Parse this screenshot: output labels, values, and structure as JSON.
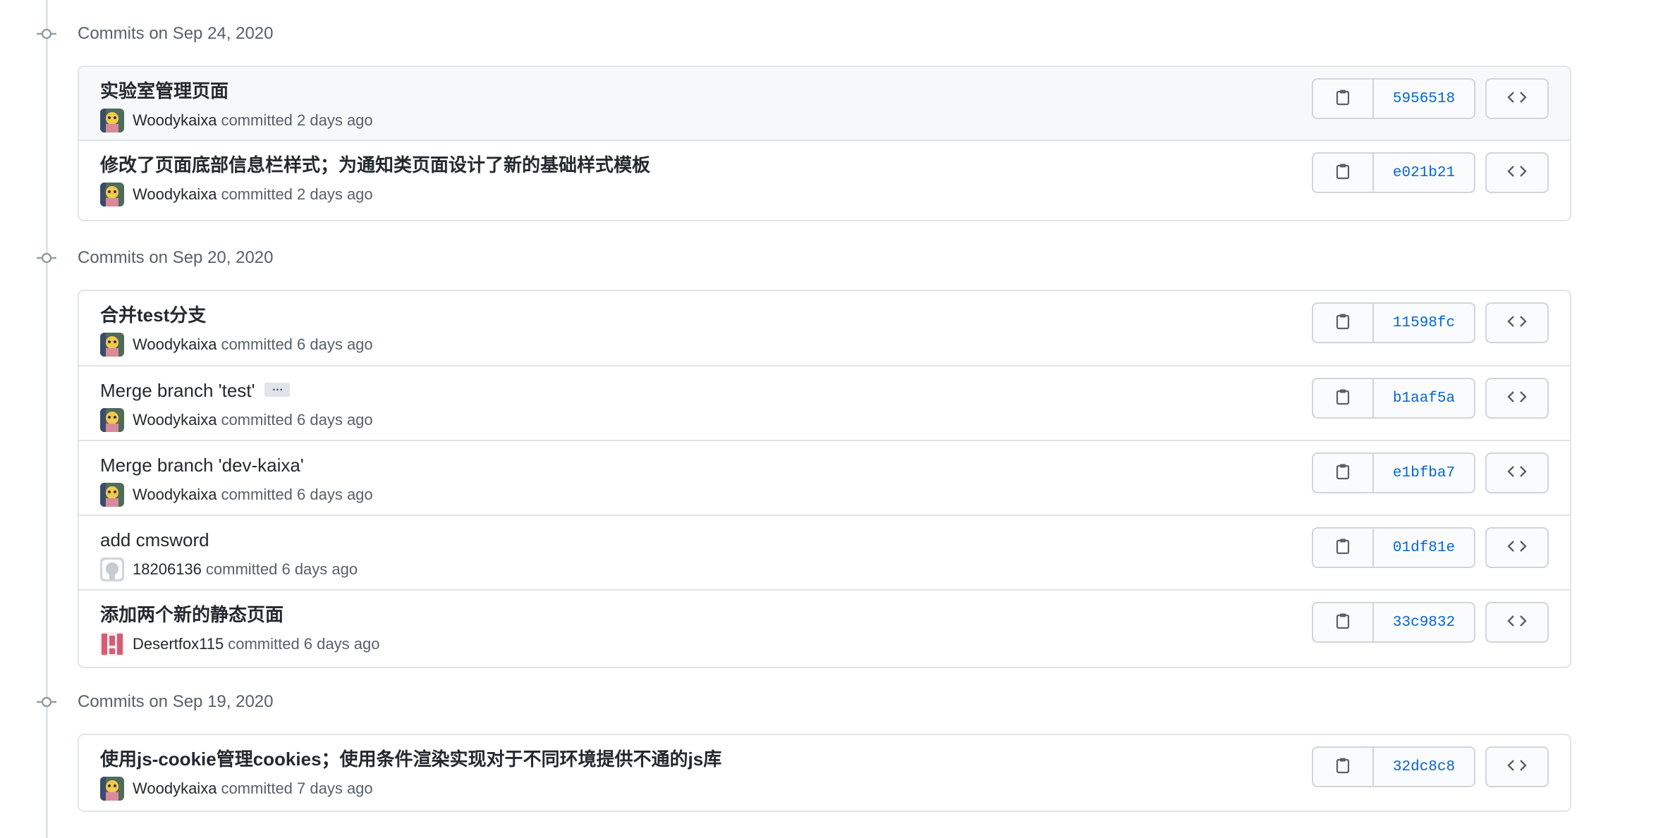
{
  "groups": [
    {
      "title": "Commits on Sep 24, 2020",
      "commits": [
        {
          "message": "实验室管理页面",
          "author": "Woodykaixa",
          "when": "committed 2 days ago",
          "sha": "5956518",
          "avatar": "woody-avatar",
          "bold": true
        },
        {
          "message": "修改了页面底部信息栏样式；为通知类页面设计了新的基础样式模板",
          "author": "Woodykaixa",
          "when": "committed 2 days ago",
          "sha": "e021b21",
          "avatar": "woody-avatar",
          "bold": true
        }
      ]
    },
    {
      "title": "Commits on Sep 20, 2020",
      "commits": [
        {
          "message": "合并test分支",
          "author": "Woodykaixa",
          "when": "committed 6 days ago",
          "sha": "11598fc",
          "avatar": "woody-avatar",
          "bold": true
        },
        {
          "message": "Merge branch 'test'",
          "author": "Woodykaixa",
          "when": "committed 6 days ago",
          "sha": "b1aaf5a",
          "avatar": "woody-avatar",
          "bold": false,
          "ellipsis": "…"
        },
        {
          "message": "Merge branch 'dev-kaixa'",
          "author": "Woodykaixa",
          "when": "committed 6 days ago",
          "sha": "e1bfba7",
          "avatar": "woody-avatar",
          "bold": false
        },
        {
          "message": "add cmsword",
          "author": "18206136",
          "when": "committed 6 days ago",
          "sha": "01df81e",
          "avatar": "default-github-avatar",
          "bold": false
        },
        {
          "message": "添加两个新的静态页面",
          "author": "Desertfox115",
          "when": "committed 6 days ago",
          "sha": "33c9832",
          "avatar": "desertfox-avatar",
          "bold": true
        }
      ]
    },
    {
      "title": "Commits on Sep 19, 2020",
      "commits": [
        {
          "message": "使用js-cookie管理cookies；使用条件渲染实现对于不同环境提供不通的js库",
          "author": "Woodykaixa",
          "when": "committed 7 days ago",
          "sha": "32dc8c8",
          "avatar": "woody-avatar",
          "bold": true
        }
      ]
    }
  ],
  "icons": {
    "copy": "clippy-icon",
    "browse": "code-icon",
    "node": "git-commit-icon"
  },
  "colors": {
    "sha_link": "#0366d6",
    "border": "#e1e4e8",
    "muted": "#586069"
  }
}
